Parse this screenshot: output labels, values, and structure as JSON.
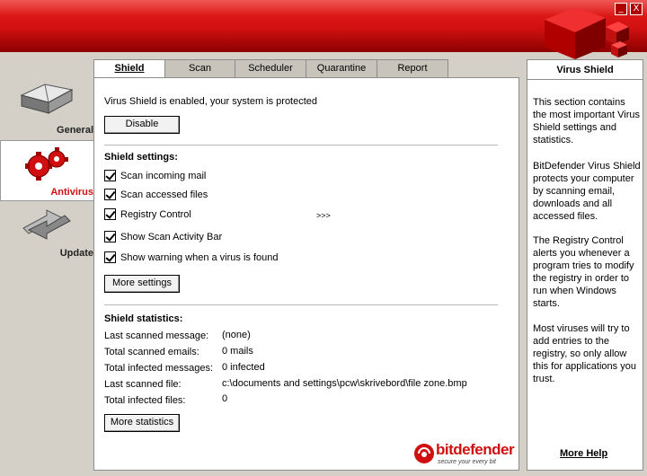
{
  "tabs": [
    {
      "label": "Shield"
    },
    {
      "label": "Scan"
    },
    {
      "label": "Scheduler"
    },
    {
      "label": "Quarantine"
    },
    {
      "label": "Report"
    }
  ],
  "nav": [
    {
      "label": "General"
    },
    {
      "label": "Antivirus"
    },
    {
      "label": "Update"
    }
  ],
  "status": "Virus Shield is enabled, your system is protected",
  "disable_label": "Disable",
  "settings": {
    "heading": "Shield settings:",
    "items": [
      {
        "label": "Scan incoming mail",
        "checked": true
      },
      {
        "label": "Scan accessed files",
        "checked": true
      },
      {
        "label": "Registry Control",
        "checked": true
      },
      {
        "label": "Show Scan Activity Bar",
        "checked": true
      },
      {
        "label": "Show warning when a virus is found",
        "checked": true
      }
    ],
    "expand": ">>>",
    "more_label": "More settings"
  },
  "stats": {
    "heading": "Shield statistics:",
    "rows": [
      {
        "label": "Last scanned message:",
        "value": "(none)"
      },
      {
        "label": "Total scanned emails:",
        "value": "0 mails"
      },
      {
        "label": "Total infected messages:",
        "value": "0 infected"
      },
      {
        "label": "Last scanned file:",
        "value": "c:\\documents and settings\\pcw\\skrivebord\\file zone.bmp"
      },
      {
        "label": "Total infected files:",
        "value": "0"
      }
    ],
    "more_label": "More statistics"
  },
  "logo": {
    "brand": "bitdefender",
    "tagline": "secure your every bit"
  },
  "info": {
    "title": "Virus Shield",
    "paragraphs": [
      "This section contains the most important Virus Shield settings and statistics.",
      "BitDefender Virus Shield protects your computer by scanning email, downloads and all accessed files.",
      "The Registry Control alerts you whenever a program tries to modify the registry in order to run when Windows starts.",
      "Most viruses will try to add entries to the registry, so only allow this for applications you trust."
    ],
    "more_help": "More Help"
  },
  "window": {
    "minimize": "_",
    "close": "X"
  },
  "colors": {
    "brand_red": "#d01010",
    "panel_bg": "#d4d0c8"
  }
}
